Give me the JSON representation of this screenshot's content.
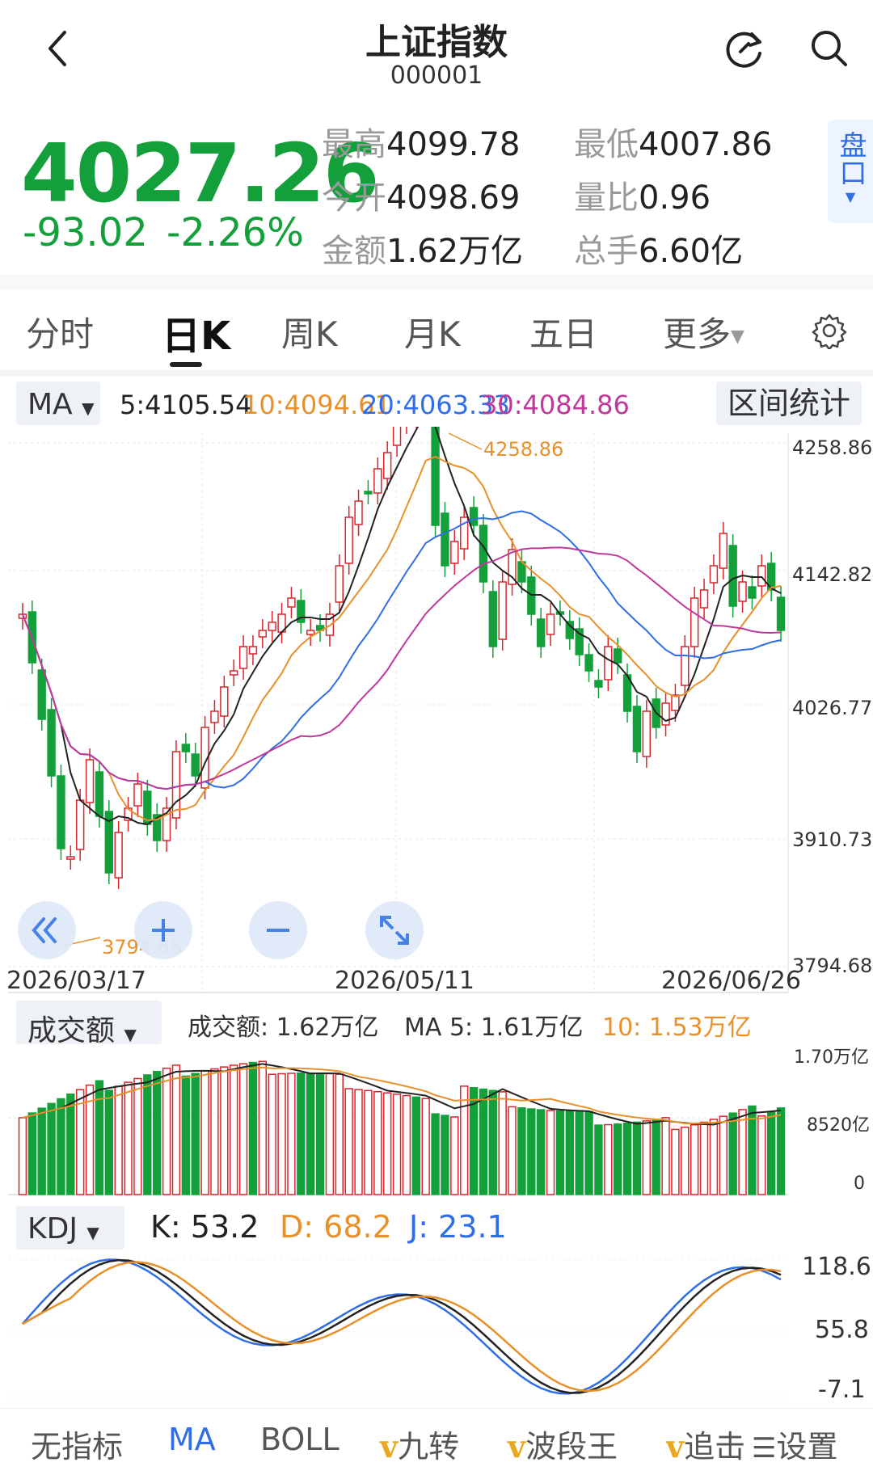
{
  "header": {
    "title": "上证指数",
    "code": "000001"
  },
  "quote": {
    "price": "4027.26",
    "change": "-93.02",
    "change_pct": "-2.26%",
    "high_label": "最高",
    "high": "4099.78",
    "low_label": "最低",
    "low": "4007.86",
    "open_label": "今开",
    "open": "4098.69",
    "vol_ratio_label": "量比",
    "vol_ratio": "0.96",
    "amount_label": "金额",
    "amount": "1.62万亿",
    "total_label": "总手",
    "total": "6.60亿",
    "pankou_label": "盘口",
    "color_down": "#13a03a",
    "color_up": "#d8262c"
  },
  "tabs": [
    "分时",
    "日K",
    "周K",
    "月K",
    "五日",
    "更多"
  ],
  "active_tab": "日K",
  "ma_row": {
    "selector": "MA",
    "ma5": "5:4105.54",
    "ma10": "10:4094.61",
    "ma20": "20:4063.33",
    "ma30": "30:4084.86",
    "range_button": "区间统计",
    "colors": {
      "ma5": "#222222",
      "ma10": "#e8902a",
      "ma20": "#2f6ee6",
      "ma30": "#c0399a"
    }
  },
  "kline": {
    "y_labels": [
      "4258.86",
      "4142.82",
      "4026.77",
      "3910.73",
      "3794.68"
    ],
    "high_marker": "4258.86",
    "low_marker": "3794.68",
    "dates": [
      "2026/03/17",
      "2026/05/11",
      "2026/06/26"
    ]
  },
  "volume": {
    "selector": "成交额",
    "amount_text": "成交额: 1.62万亿",
    "ma5_text": "MA 5: 1.61万亿",
    "ma10_text": "10: 1.53万亿",
    "y_labels": [
      "1.70万亿",
      "8520亿",
      "0"
    ]
  },
  "kdj": {
    "selector": "KDJ",
    "k": "K: 53.2",
    "d": "D: 68.2",
    "j": "J: 23.1",
    "y_labels": [
      "118.6",
      "55.8",
      "-7.1"
    ]
  },
  "bottom_bar": {
    "none": "无指标",
    "ma": "MA",
    "boll": "BOLL",
    "v": "v",
    "jiuzhuan": "九转",
    "boduanwang": "波段王",
    "zhui": "追击",
    "settings": "设置"
  }
}
